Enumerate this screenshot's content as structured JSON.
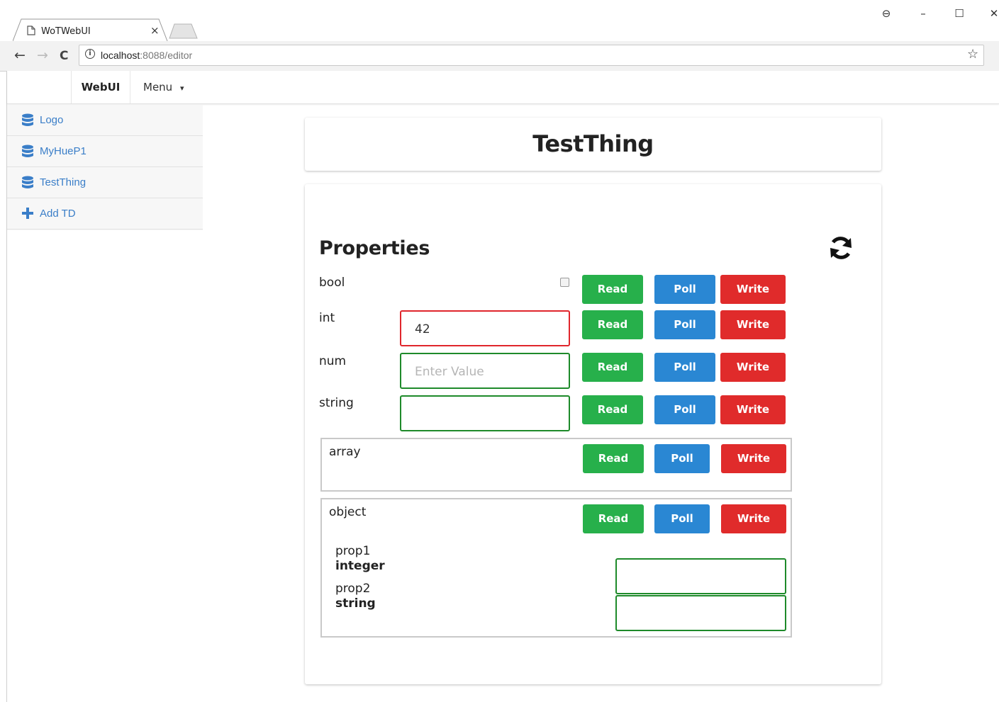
{
  "browser": {
    "tab_title": "WoTWebUI",
    "tab_close": "×",
    "url_host": "localhost",
    "url_path": ":8088/editor",
    "info_glyph": "i",
    "back_glyph": "←",
    "forward_glyph": "→",
    "reload_glyph": "C",
    "star_glyph": "☆",
    "minimize_glyph": "–",
    "maximize_glyph": "☐",
    "close_glyph": "✕",
    "profile_glyph": "⊖"
  },
  "navbar": {
    "brand": "WebUI",
    "menu_label": "Menu",
    "menu_caret": "▾"
  },
  "sidebar": {
    "items": [
      {
        "label": "Logo",
        "icon": "database-icon"
      },
      {
        "label": "MyHueP1",
        "icon": "database-icon"
      },
      {
        "label": "TestThing",
        "icon": "database-icon"
      },
      {
        "label": "Add TD",
        "icon": "plus-icon"
      }
    ]
  },
  "thing": {
    "title": "TestThing",
    "section_title": "Properties",
    "buttons": {
      "read": "Read",
      "poll": "Poll",
      "write": "Write"
    },
    "properties": {
      "bool": {
        "label": "bool"
      },
      "int": {
        "label": "int",
        "value": "42"
      },
      "num": {
        "label": "num",
        "placeholder": "Enter Value"
      },
      "string": {
        "label": "string"
      },
      "array": {
        "label": "array"
      },
      "object": {
        "label": "object",
        "prop1": {
          "name": "prop1",
          "type": "integer"
        },
        "prop2": {
          "name": "prop2",
          "type": "string"
        }
      }
    }
  },
  "colors": {
    "read": "#27b04b",
    "poll": "#2a87d3",
    "write": "#e02b2b",
    "valid_border": "#1e8a2a",
    "invalid_border": "#e0262c",
    "link": "#3a7ec8"
  }
}
